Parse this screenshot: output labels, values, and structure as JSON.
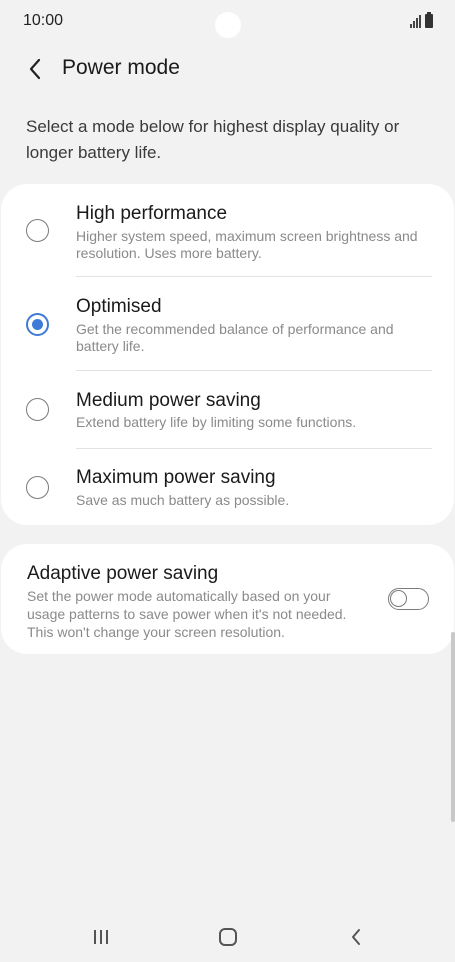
{
  "status_bar": {
    "time": "10:00",
    "icons": [
      "signal-icon",
      "battery-icon"
    ]
  },
  "header": {
    "title": "Power mode",
    "back_icon": "chevron-left-icon"
  },
  "intro": "Select a mode below for highest display quality or longer battery life.",
  "modes": [
    {
      "title": "High performance",
      "description": "Higher system speed, maximum screen brightness and resolution. Uses more battery.",
      "selected": false
    },
    {
      "title": "Optimised",
      "description": "Get the recommended balance of performance and battery life.",
      "selected": true
    },
    {
      "title": "Medium power saving",
      "description": "Extend battery life by limiting some functions.",
      "selected": false
    },
    {
      "title": "Maximum power saving",
      "description": "Save as much battery as possible.",
      "selected": false
    }
  ],
  "adaptive": {
    "title": "Adaptive power saving",
    "description": "Set the power mode automatically based on your usage patterns to save power when it's not needed. This won't change your screen resolution.",
    "enabled": false
  },
  "nav_bar": {
    "icons": [
      "recent-apps-icon",
      "home-icon",
      "back-icon"
    ]
  },
  "colors": {
    "accent": "#3e7bd6",
    "background": "#f2f2f2",
    "card": "#ffffff"
  }
}
